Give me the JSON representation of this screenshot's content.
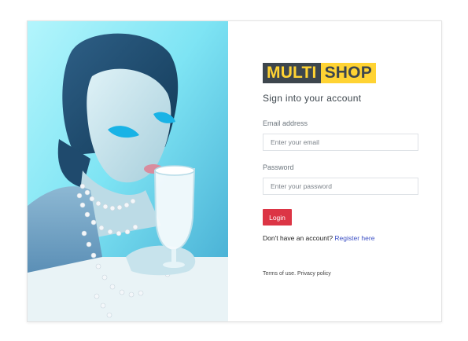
{
  "logo": {
    "part1": "MULTI",
    "part2": "SHOP"
  },
  "title": "Sign into your account",
  "form": {
    "email_label": "Email address",
    "email_placeholder": "Enter your email",
    "email_value": "",
    "password_label": "Password",
    "password_placeholder": "Enter your password",
    "password_value": "",
    "login_label": "Login"
  },
  "register": {
    "prompt": "Don't have an account?",
    "link": "Register here"
  },
  "footer": {
    "terms": "Terms of use.",
    "privacy": "Privacy policy"
  },
  "colors": {
    "brand_dark": "#3d464d",
    "brand_yellow": "#ffd333",
    "login_red": "#dc3545",
    "link_blue": "#3b4fc4"
  },
  "icons": {
    "hero_image": "woman-with-pearls-drinking-milk-photo"
  }
}
